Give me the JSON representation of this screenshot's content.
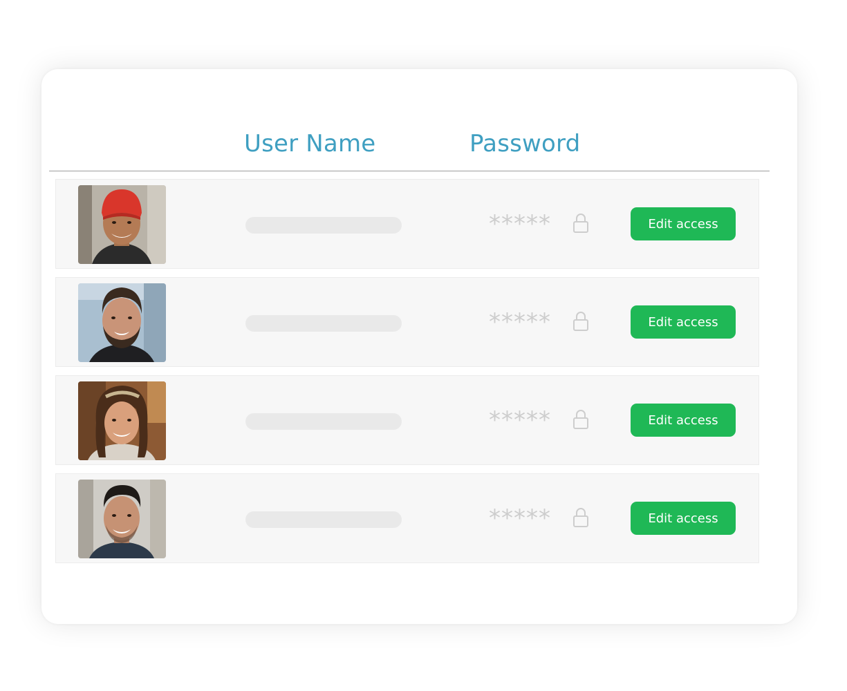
{
  "table": {
    "headers": {
      "username": "User Name",
      "password": "Password"
    },
    "rows": [
      {
        "avatar": "smiling-man-red-beanie-photo",
        "password_mask": "*****",
        "button_label": "Edit access"
      },
      {
        "avatar": "bearded-man-photo",
        "password_mask": "*****",
        "button_label": "Edit access"
      },
      {
        "avatar": "smiling-woman-headband-photo",
        "password_mask": "*****",
        "button_label": "Edit access"
      },
      {
        "avatar": "smiling-man-short-hair-photo",
        "password_mask": "*****",
        "button_label": "Edit access"
      }
    ]
  },
  "colors": {
    "header_text": "#3f9fc1",
    "button_bg": "#1fb856",
    "row_bg": "#f7f7f7",
    "mask_text": "#cdcdcd"
  }
}
